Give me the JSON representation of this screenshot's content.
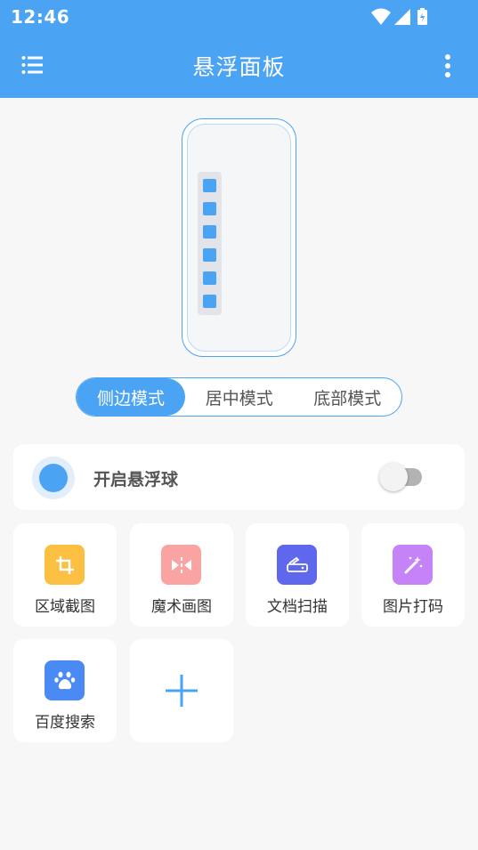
{
  "status_bar": {
    "time": "12:46"
  },
  "app_bar": {
    "title": "悬浮面板"
  },
  "preview": {
    "dot_count": 6
  },
  "mode_selector": {
    "options": [
      "侧边模式",
      "居中模式",
      "底部模式"
    ],
    "selected": "侧边模式"
  },
  "floating_ball": {
    "label": "开启悬浮球",
    "enabled": false
  },
  "tools": [
    {
      "label": "区域截图",
      "icon": "crop-icon",
      "color": "#fbbf42"
    },
    {
      "label": "魔术画图",
      "icon": "magic-draw-icon",
      "color": "#f9a3a3"
    },
    {
      "label": "文档扫描",
      "icon": "scanner-icon",
      "color": "#5f67ec"
    },
    {
      "label": "图片打码",
      "icon": "magic-wand-icon",
      "color": "#c583f7"
    },
    {
      "label": "百度搜索",
      "icon": "baidu-paw-icon",
      "color": "#4a8af4"
    }
  ],
  "colors": {
    "primary": "#4aa3f3",
    "background": "#f7f7f8"
  }
}
